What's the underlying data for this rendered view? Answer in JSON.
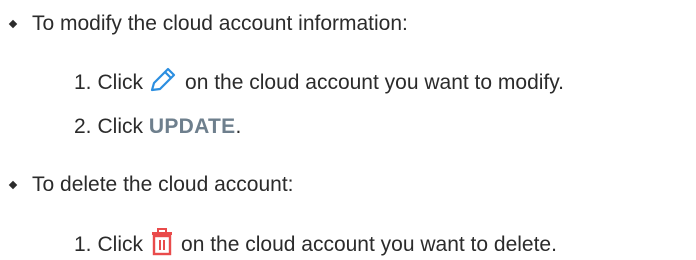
{
  "doc": {
    "bullets": [
      {
        "text": "To modify the cloud account information:",
        "steps": [
          {
            "num": "1.",
            "before": "Click",
            "icon": "edit-pencil-icon",
            "after": "on the cloud account you want to modify."
          },
          {
            "num": "2.",
            "before": "Click",
            "keyword": "UPDATE",
            "after": "."
          }
        ]
      },
      {
        "text": "To delete the cloud account:",
        "steps": [
          {
            "num": "1.",
            "before": "Click",
            "icon": "trash-icon",
            "after": "on the cloud account you want to delete."
          }
        ]
      }
    ],
    "colors": {
      "text": "#2b2b2b",
      "keyword": "#6e7f8d",
      "pencil": "#2b8ee0",
      "trash": "#e94b4b"
    }
  }
}
